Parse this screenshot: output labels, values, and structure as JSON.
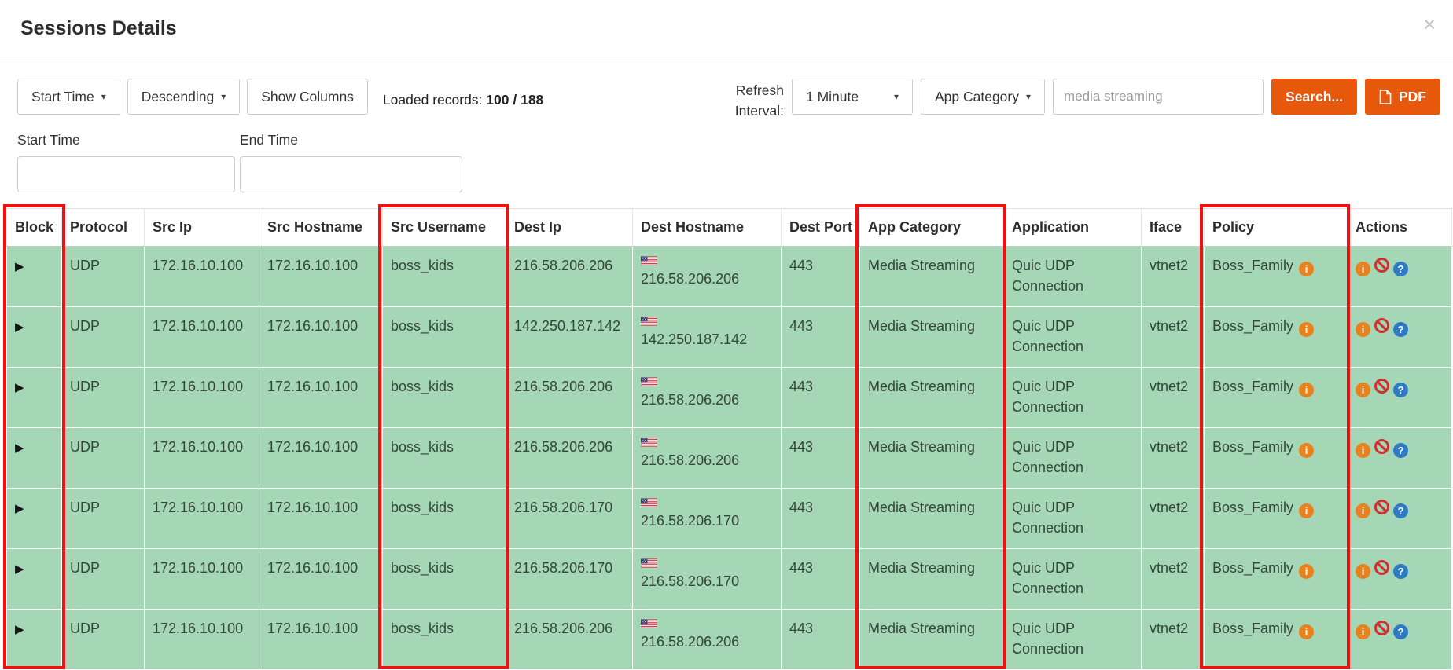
{
  "modal": {
    "title": "Sessions Details"
  },
  "icons": {
    "close": "×",
    "caret_down": "▾",
    "play": "▶",
    "info": "i",
    "help": "?"
  },
  "toolbar": {
    "sort_field_button": "Start Time",
    "sort_order_button": "Descending",
    "show_columns_button": "Show Columns",
    "loaded_records_label": "Loaded records:",
    "loaded_records_value": "100 / 188",
    "refresh_interval_label": "Refresh Interval:",
    "refresh_interval_selected": "1 Minute",
    "app_category_button": "App Category",
    "search_input_value": "media streaming",
    "search_button_label": "Search...",
    "pdf_button_label": "PDF"
  },
  "time_filters": {
    "start_time_label": "Start Time",
    "end_time_label": "End Time",
    "start_time_value": "",
    "end_time_value": ""
  },
  "table": {
    "columns": [
      "Block",
      "Protocol",
      "Src Ip",
      "Src Hostname",
      "Src Username",
      "Dest Ip",
      "Dest Hostname",
      "Dest Port",
      "App Category",
      "Application",
      "Iface",
      "Policy",
      "Actions"
    ],
    "highlighted_columns": [
      "Block",
      "Src Username",
      "App Category",
      "Policy"
    ],
    "rows": [
      {
        "protocol": "UDP",
        "src_ip": "172.16.10.100",
        "src_hostname": "172.16.10.100",
        "src_username": "boss_kids",
        "dest_ip": "216.58.206.206",
        "dest_hostname": "216.58.206.206",
        "dest_port": "443",
        "app_category": "Media Streaming",
        "application": "Quic UDP Connection",
        "iface": "vtnet2",
        "policy": "Boss_Family"
      },
      {
        "protocol": "UDP",
        "src_ip": "172.16.10.100",
        "src_hostname": "172.16.10.100",
        "src_username": "boss_kids",
        "dest_ip": "142.250.187.142",
        "dest_hostname": "142.250.187.142",
        "dest_port": "443",
        "app_category": "Media Streaming",
        "application": "Quic UDP Connection",
        "iface": "vtnet2",
        "policy": "Boss_Family"
      },
      {
        "protocol": "UDP",
        "src_ip": "172.16.10.100",
        "src_hostname": "172.16.10.100",
        "src_username": "boss_kids",
        "dest_ip": "216.58.206.206",
        "dest_hostname": "216.58.206.206",
        "dest_port": "443",
        "app_category": "Media Streaming",
        "application": "Quic UDP Connection",
        "iface": "vtnet2",
        "policy": "Boss_Family"
      },
      {
        "protocol": "UDP",
        "src_ip": "172.16.10.100",
        "src_hostname": "172.16.10.100",
        "src_username": "boss_kids",
        "dest_ip": "216.58.206.206",
        "dest_hostname": "216.58.206.206",
        "dest_port": "443",
        "app_category": "Media Streaming",
        "application": "Quic UDP Connection",
        "iface": "vtnet2",
        "policy": "Boss_Family"
      },
      {
        "protocol": "UDP",
        "src_ip": "172.16.10.100",
        "src_hostname": "172.16.10.100",
        "src_username": "boss_kids",
        "dest_ip": "216.58.206.170",
        "dest_hostname": "216.58.206.170",
        "dest_port": "443",
        "app_category": "Media Streaming",
        "application": "Quic UDP Connection",
        "iface": "vtnet2",
        "policy": "Boss_Family"
      },
      {
        "protocol": "UDP",
        "src_ip": "172.16.10.100",
        "src_hostname": "172.16.10.100",
        "src_username": "boss_kids",
        "dest_ip": "216.58.206.170",
        "dest_hostname": "216.58.206.170",
        "dest_port": "443",
        "app_category": "Media Streaming",
        "application": "Quic UDP Connection",
        "iface": "vtnet2",
        "policy": "Boss_Family"
      },
      {
        "protocol": "UDP",
        "src_ip": "172.16.10.100",
        "src_hostname": "172.16.10.100",
        "src_username": "boss_kids",
        "dest_ip": "216.58.206.206",
        "dest_hostname": "216.58.206.206",
        "dest_port": "443",
        "app_category": "Media Streaming",
        "application": "Quic UDP Connection",
        "iface": "vtnet2",
        "policy": "Boss_Family"
      }
    ]
  },
  "colors": {
    "row_green": "#a5d6b5",
    "button_orange": "#e8580c",
    "highlight_red": "#ee1111",
    "info_orange": "#e8821e",
    "block_red": "#cf3030",
    "help_blue": "#2e7bc4"
  }
}
